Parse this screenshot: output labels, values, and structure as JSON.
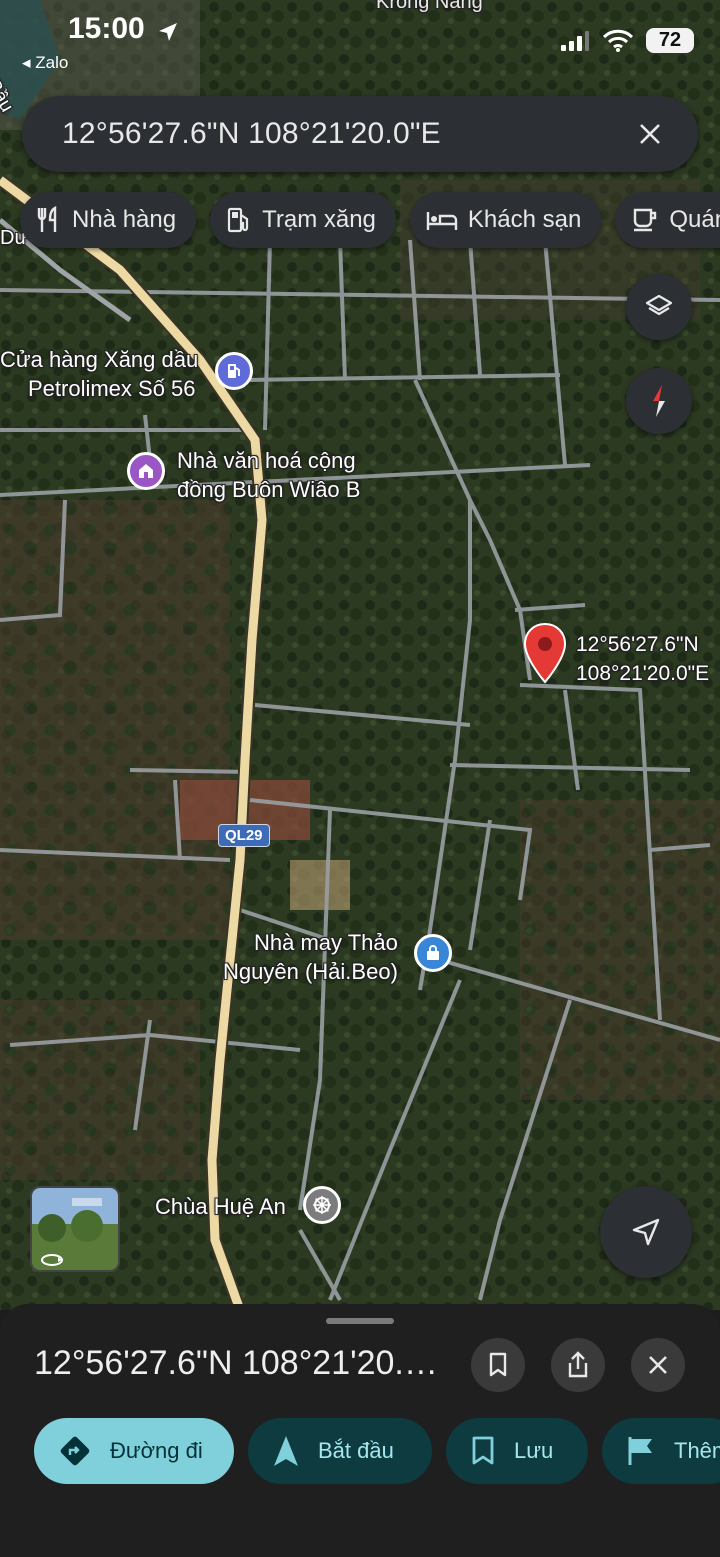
{
  "status_bar": {
    "time": "15:00",
    "back_app": "◂ Zalo",
    "battery": "72"
  },
  "search": {
    "value": "12°56'27.6\"N 108°21'20.0\"E"
  },
  "chips": [
    {
      "label": "Nhà hàng",
      "icon": "fork-knife-icon"
    },
    {
      "label": "Trạm xăng",
      "icon": "gas-pump-icon"
    },
    {
      "label": "Khách sạn",
      "icon": "bed-icon"
    },
    {
      "label": "Quán",
      "icon": "coffee-cup-icon"
    }
  ],
  "map": {
    "top_labels": [
      "Krông Năng",
      "Bầu",
      "Dư"
    ],
    "pin_label_line1": "12°56'27.6\"N",
    "pin_label_line2": "108°21'20.0\"E",
    "road_shield": "QL29",
    "places": [
      {
        "line1": "Cửa hàng Xăng dầu",
        "line2": "Petrolimex Số 56",
        "icon": "gas-pump-icon",
        "color": "#5f6bd8"
      },
      {
        "line1": "Nhà văn hoá cộng",
        "line2": "đồng Buôn Wiâo B",
        "icon": "community-hall-icon",
        "color": "#9a56c4"
      },
      {
        "line1": "Nhà may Thảo",
        "line2": "Nguyên (Hải.Beo)",
        "icon": "shopping-bag-icon",
        "color": "#3a86d6"
      },
      {
        "line1": "Chùa Huệ An",
        "line2": "",
        "icon": "dharma-wheel-icon",
        "color": "#7c7c7c"
      }
    ],
    "pin_color": "#e53935"
  },
  "sheet": {
    "title": "12°56'27.6\"N 108°21'20.0\"E",
    "actions": [
      {
        "label": "Đường đi",
        "icon": "directions-icon"
      },
      {
        "label": "Bắt đầu",
        "icon": "navigation-arrow-icon"
      },
      {
        "label": "Lưu",
        "icon": "bookmark-icon"
      },
      {
        "label": "Thêm",
        "icon": "flag-icon"
      }
    ]
  },
  "colors": {
    "accent": "#7fd0da",
    "chip_bg": "#2c2f33",
    "sheet_bg": "#1f1f1f"
  }
}
